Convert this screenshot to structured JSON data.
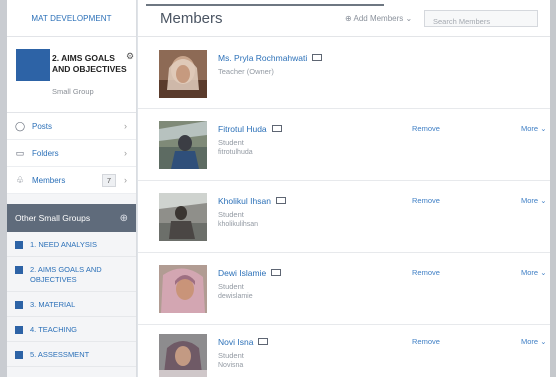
{
  "sidebar": {
    "top_link": "MAT DEVELOPMENT",
    "group": {
      "name": "2. AIMS GOALS AND OBJECTIVES",
      "type": "Small Group"
    },
    "nav": [
      {
        "label": "Posts",
        "icon": "speech-bubble-icon"
      },
      {
        "label": "Folders",
        "icon": "folder-icon"
      },
      {
        "label": "Members",
        "icon": "members-icon",
        "count": "7"
      }
    ],
    "other_heading": "Other Small Groups",
    "other_groups": [
      {
        "label": "1. NEED ANALYSIS"
      },
      {
        "label": "2. AIMS GOALS AND OBJECTIVES"
      },
      {
        "label": "3. MATERIAL"
      },
      {
        "label": "4. TEACHING"
      },
      {
        "label": "5. ASSESSMENT"
      }
    ]
  },
  "main": {
    "title": "Members",
    "add_members_label": "Add Members",
    "search_placeholder": "Search Members",
    "members": [
      {
        "name": "Ms. Pryla Rochmahwati",
        "role": "Teacher (Owner)",
        "username": "",
        "remove": "",
        "more": ""
      },
      {
        "name": "Fitrotul Huda",
        "role": "Student",
        "username": "fitrotulhuda",
        "remove": "Remove",
        "more": "More"
      },
      {
        "name": "Kholikul Ihsan",
        "role": "Student",
        "username": "kholikulihsan",
        "remove": "Remove",
        "more": "More"
      },
      {
        "name": "Dewi Islamie",
        "role": "Student",
        "username": "dewislamie",
        "remove": "Remove",
        "more": "More"
      },
      {
        "name": "Novi Isna",
        "role": "Student",
        "username": "Novisna",
        "remove": "Remove",
        "more": "More"
      }
    ]
  },
  "colors": {
    "accent": "#2b70b8",
    "group_blue": "#2d63a6",
    "other_header": "#5f6b7b"
  }
}
